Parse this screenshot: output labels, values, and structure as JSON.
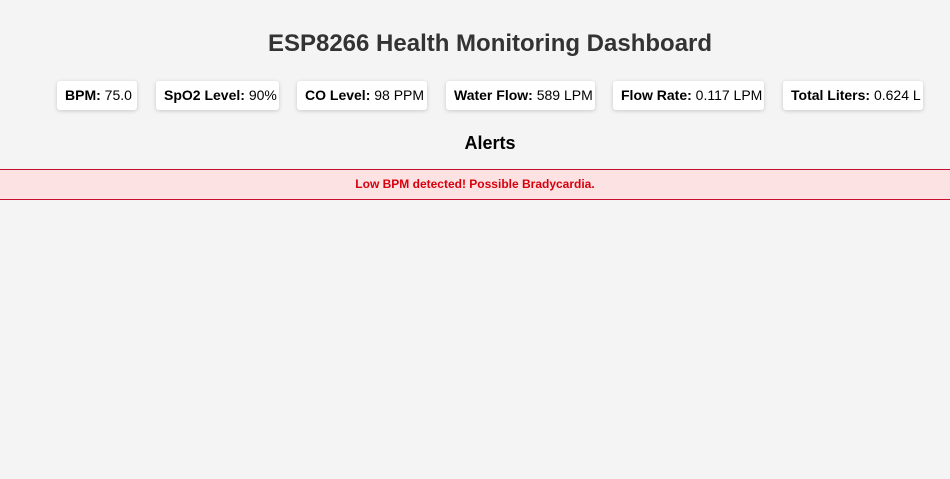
{
  "header": {
    "title": "ESP8266 Health Monitoring Dashboard"
  },
  "metrics": [
    {
      "label": "BPM:",
      "value": "75.0"
    },
    {
      "label": "SpO2 Level:",
      "value": "90%"
    },
    {
      "label": "CO Level:",
      "value": "98 PPM"
    },
    {
      "label": "Water Flow:",
      "value": "589 LPM"
    },
    {
      "label": "Flow Rate:",
      "value": "0.117 LPM"
    },
    {
      "label": "Total Liters:",
      "value": "0.624 L"
    }
  ],
  "alerts": {
    "heading": "Alerts",
    "items": [
      {
        "message": "Low BPM detected! Possible Bradycardia."
      }
    ]
  },
  "colors": {
    "background": "#f4f4f4",
    "title": "#333333",
    "alert_bg": "#fde2e4",
    "alert_border": "#c8102e",
    "alert_text": "#d8000c"
  }
}
